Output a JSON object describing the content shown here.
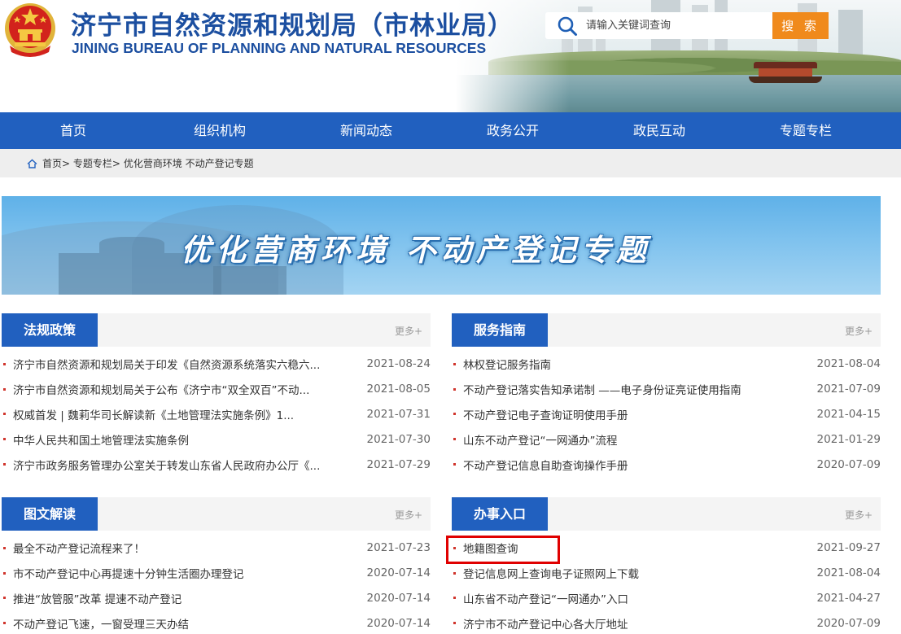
{
  "header": {
    "title_cn": "济宁市自然资源和规划局（市林业局）",
    "title_en": "JINING BUREAU OF PLANNING AND NATURAL RESOURCES",
    "emblem_icon": "national-emblem-icon",
    "search": {
      "placeholder": "请输入关键词查询",
      "value": "",
      "button_label": "搜 索"
    }
  },
  "nav": {
    "items": [
      {
        "label": "首页"
      },
      {
        "label": "组织机构"
      },
      {
        "label": "新闻动态"
      },
      {
        "label": "政务公开"
      },
      {
        "label": "政民互动"
      },
      {
        "label": "专题专栏"
      }
    ]
  },
  "breadcrumb": {
    "home_icon": "home-icon",
    "items": [
      "首页",
      "专题专栏",
      "优化营商环境 不动产登记专题"
    ],
    "separator": ">"
  },
  "banner": {
    "title": "优化营商环境  不动产登记专题"
  },
  "panels": {
    "laws": {
      "title": "法规政策",
      "more": "更多+",
      "items": [
        {
          "title": "济宁市自然资源和规划局关于印发《自然资源系统落实六稳六...",
          "date": "2021-08-24"
        },
        {
          "title": "济宁市自然资源和规划局关于公布《济宁市“双全双百”不动...",
          "date": "2021-08-05"
        },
        {
          "title": "权威首发 | 魏莉华司长解读新《土地管理法实施条例》1...",
          "date": "2021-07-31"
        },
        {
          "title": "中华人民共和国土地管理法实施条例",
          "date": "2021-07-30"
        },
        {
          "title": "济宁市政务服务管理办公室关于转发山东省人民政府办公厅《...",
          "date": "2021-07-29"
        }
      ]
    },
    "guide": {
      "title": "服务指南",
      "more": "更多+",
      "items": [
        {
          "title": "林权登记服务指南",
          "date": "2021-08-04"
        },
        {
          "title": "不动产登记落实告知承诺制 ——电子身份证亮证使用指南",
          "date": "2021-07-09"
        },
        {
          "title": "不动产登记电子查询证明使用手册",
          "date": "2021-04-15"
        },
        {
          "title": "山东不动产登记“一网通办”流程",
          "date": "2021-01-29"
        },
        {
          "title": "不动产登记信息自助查询操作手册",
          "date": "2020-07-09"
        }
      ]
    },
    "graphics": {
      "title": "图文解读",
      "more": "更多+",
      "items": [
        {
          "title": "最全不动产登记流程来了！",
          "date": "2021-07-23"
        },
        {
          "title": "市不动产登记中心再提速十分钟生活圈办理登记",
          "date": "2020-07-14"
        },
        {
          "title": "推进“放管服”改革 提速不动产登记",
          "date": "2020-07-14"
        },
        {
          "title": "不动产登记飞速，一窗受理三天办结",
          "date": "2020-07-14"
        }
      ]
    },
    "entry": {
      "title": "办事入口",
      "more": "更多+",
      "items": [
        {
          "title": "地籍图查询",
          "date": "2021-09-27"
        },
        {
          "title": "登记信息网上查询电子证照网上下载",
          "date": "2021-08-04"
        },
        {
          "title": "山东省不动产登记“一网通办”入口",
          "date": "2021-04-27"
        },
        {
          "title": "济宁市不动产登记中心各大厅地址",
          "date": "2020-07-09"
        }
      ]
    }
  },
  "colors": {
    "primary_blue": "#2160bf",
    "title_blue": "#1c4fa0",
    "search_orange": "#f08a1c",
    "bullet_red": "#d0342c",
    "highlight_red": "#e00000"
  }
}
